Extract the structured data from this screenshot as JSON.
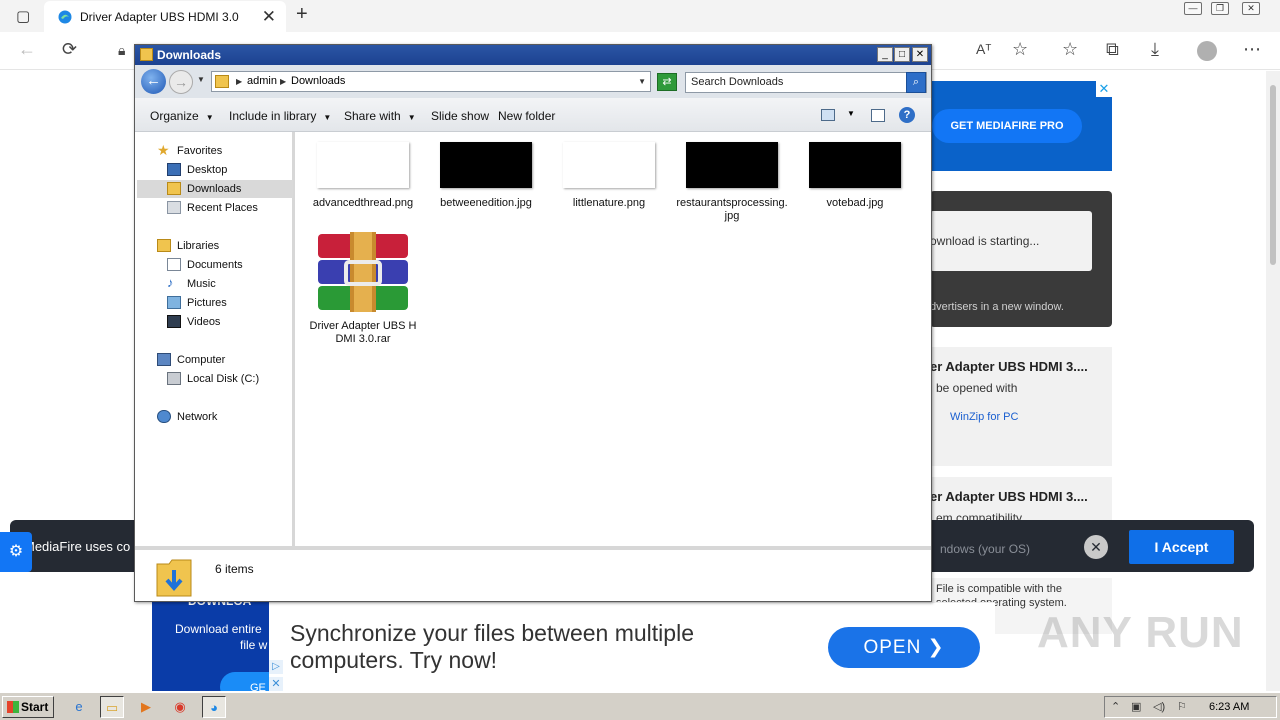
{
  "browser": {
    "tab_title": "Driver Adapter UBS HDMI 3.0",
    "tab_close": "✕",
    "new_tab": "+",
    "reader_icon_text": "Aᵀ"
  },
  "webpage": {
    "mediafire_button": "GET MEDIAFIRE PRO",
    "ad_close": "✕",
    "download_starting": "ownload is starting...",
    "advertisers_note": "dvertisers in a new window.",
    "card1_title": "er Adapter UBS HDMI 3....",
    "card1_sub": "be opened with",
    "card1_link": "WinZip for PC",
    "card2_title": "er Adapter UBS HDMI 3....",
    "card2_sub": "em compatibility",
    "cookie_text": "MediaFire uses co",
    "cookie_os": "ndows (your OS)",
    "cookie_accept": "I Accept",
    "cookie_close": "✕",
    "compat_text_1": "File is compatible with the",
    "compat_text_2": "selected operating system.",
    "promo_head": "DOWNLOA",
    "promo_line1": "Download entire",
    "promo_line2": "file w",
    "promo_pill": "GE",
    "ad_text": "Synchronize your files between multiple computers. Try now!",
    "ad_open": "OPEN  ❯",
    "watermark": "ANY RUN"
  },
  "explorer": {
    "title": "Downloads",
    "breadcrumb": [
      "admin",
      "Downloads"
    ],
    "search_placeholder": "Search Downloads",
    "commands": {
      "organize": "Organize",
      "include_in_library": "Include in library",
      "share_with": "Share with",
      "slide_show": "Slide show",
      "new_folder": "New folder"
    },
    "nav": {
      "favorites": "Favorites",
      "desktop": "Desktop",
      "downloads": "Downloads",
      "recent_places": "Recent Places",
      "libraries": "Libraries",
      "documents": "Documents",
      "music": "Music",
      "pictures": "Pictures",
      "videos": "Videos",
      "computer": "Computer",
      "local_disk": "Local Disk (C:)",
      "network": "Network"
    },
    "files": [
      {
        "name": "advancedthread.png",
        "thumb_color": "#ffffff"
      },
      {
        "name": "betweenedition.jpg",
        "thumb_color": "#000000"
      },
      {
        "name": "littlenature.png",
        "thumb_color": "#ffffff"
      },
      {
        "name": "restaurantsprocessing.jpg",
        "thumb_color": "#000000"
      },
      {
        "name": "votebad.jpg",
        "thumb_color": "#000000"
      },
      {
        "name": "Driver Adapter UBS HDMI 3.0.rar",
        "thumb_color": "winrar"
      }
    ],
    "status_count": "6 items"
  },
  "taskbar": {
    "start": "Start",
    "clock": "6:23 AM"
  },
  "colors": {
    "titlebar": "#1c4290",
    "accent_blue": "#1276f5",
    "cookie_bg": "#252a33"
  }
}
